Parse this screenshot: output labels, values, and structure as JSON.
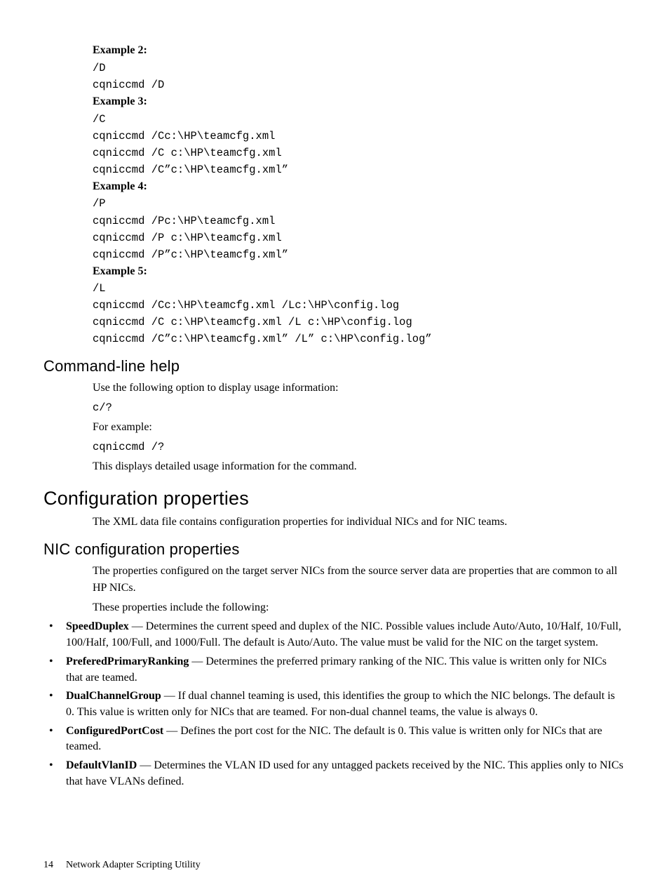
{
  "examples": {
    "ex2": {
      "heading": "Example 2:",
      "lines": [
        "/D",
        "cqniccmd /D"
      ]
    },
    "ex3": {
      "heading": "Example 3:",
      "lines": [
        "/C",
        "cqniccmd /Cc:\\HP\\teamcfg.xml",
        "cqniccmd /C c:\\HP\\teamcfg.xml",
        "cqniccmd /C”c:\\HP\\teamcfg.xml”"
      ]
    },
    "ex4": {
      "heading": "Example 4:",
      "lines": [
        "/P",
        "cqniccmd /Pc:\\HP\\teamcfg.xml",
        "cqniccmd /P c:\\HP\\teamcfg.xml",
        "cqniccmd /P”c:\\HP\\teamcfg.xml”"
      ]
    },
    "ex5": {
      "heading": "Example 5:",
      "lines": [
        "/L",
        "cqniccmd /Cc:\\HP\\teamcfg.xml /Lc:\\HP\\config.log",
        "cqniccmd /C c:\\HP\\teamcfg.xml /L c:\\HP\\config.log",
        "cqniccmd /C”c:\\HP\\teamcfg.xml” /L” c:\\HP\\config.log”"
      ]
    }
  },
  "cmdhelp": {
    "heading": "Command-line help",
    "intro": "Use the following option to display usage information:",
    "opt": "c/?",
    "for_example": "For example:",
    "example": "cqniccmd /?",
    "outro": "This displays detailed usage information for the command."
  },
  "config": {
    "heading": "Configuration properties",
    "intro": "The XML data file contains configuration properties for individual NICs and for NIC teams."
  },
  "nicconfig": {
    "heading": "NIC configuration properties",
    "p1": "The properties configured on the target server NICs from the source server data are properties that are common to all HP NICs.",
    "p2": "These properties include the following:",
    "items": [
      {
        "term": "SpeedDuplex",
        "desc": " — Determines the current speed and duplex of the NIC. Possible values include Auto/Auto, 10/Half, 10/Full, 100/Half, 100/Full, and 1000/Full. The default is Auto/Auto. The value must be valid for the NIC on the target system."
      },
      {
        "term": "PreferedPrimaryRanking",
        "desc": " — Determines the preferred primary ranking of the NIC. This value is written only for NICs that are teamed."
      },
      {
        "term": "DualChannelGroup",
        "desc": " — If dual channel teaming is used, this identifies the group to which the NIC belongs. The default is 0. This value is written only for NICs that are teamed. For non-dual channel teams, the value is always 0."
      },
      {
        "term": "ConfiguredPortCost",
        "desc": " — Defines the port cost for the NIC. The default is 0. This value is written only for NICs that are teamed."
      },
      {
        "term": "DefaultVlanID",
        "desc": " — Determines the VLAN ID used for any untagged packets received by the NIC. This applies only to NICs that have VLANs defined."
      }
    ]
  },
  "footer": {
    "pagenum": "14",
    "section": "Network Adapter Scripting Utility"
  }
}
